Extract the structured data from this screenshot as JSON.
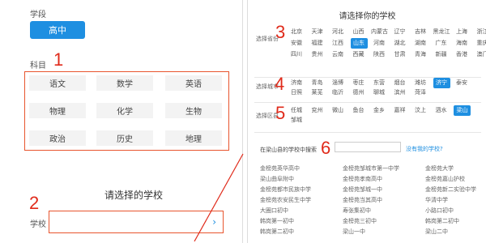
{
  "left": {
    "stage_label": "学段",
    "stage_value": "高中",
    "subject_label": "科目",
    "subjects": [
      "语文",
      "数学",
      "英语",
      "物理",
      "化学",
      "生物",
      "政治",
      "历史",
      "地理"
    ],
    "school_title": "请选择的学校",
    "school_label": "学校",
    "chevron": "›"
  },
  "right": {
    "title": "请选择你的学校",
    "province_label": "选择省份",
    "provinces": [
      "北京",
      "天津",
      "河北",
      "山西",
      "内蒙古",
      "辽宁",
      "吉林",
      "黑龙江",
      "上海",
      "浙江",
      "安徽",
      "福建",
      "江西",
      "山东",
      "河南",
      "湖北",
      "湖南",
      "广东",
      "海南",
      "重庆",
      "四川",
      "贵州",
      "云南",
      "西藏",
      "陕西",
      "甘肃",
      "青海",
      "新疆",
      "香港",
      "澳门"
    ],
    "selected_province": "山东",
    "city_label": "选择城市",
    "cities": [
      "济南",
      "青岛",
      "淄博",
      "枣庄",
      "东营",
      "烟台",
      "潍坊",
      "济宁",
      "泰安",
      "日照",
      "莱芜",
      "临沂",
      "德州",
      "聊城",
      "滨州",
      "菏泽"
    ],
    "selected_city": "济宁",
    "district_label": "选择区县",
    "districts": [
      "任城",
      "兖州",
      "微山",
      "鱼台",
      "金乡",
      "嘉祥",
      "汶上",
      "泗水",
      "梁山",
      "邹城"
    ],
    "selected_district": "梁山",
    "search_label": "在梁山县的学校中搜索",
    "no_school_link": "没有我的学校?",
    "schools": [
      [
        "金榜苑英华高中",
        "金榜苑邹城市第一中学",
        "金榜苑大学"
      ],
      [
        "梁山曲阜附中",
        "金榜苑孝南高中",
        "金榜苑嘉山护校"
      ],
      [
        "金榜苑都市民族中学",
        "金榜苑邹城一中",
        "金榜苑新二实验中学"
      ],
      [
        "金榜苑农安民生中学",
        "金榜苑当其高中",
        "华清中学"
      ],
      [
        "大圈口初中",
        "寿张集初中",
        "小路口初中"
      ],
      [
        "韩岗第一初中",
        "金榜苑三初中",
        "韩岗第二初中"
      ],
      [
        "韩岗第二初中",
        "梁山一中",
        "梁山二中"
      ]
    ]
  },
  "annotations": [
    "1",
    "2",
    "3",
    "4",
    "5",
    "6"
  ],
  "colors": {
    "accent": "#1e8fe1",
    "annotation": "#e02a1a",
    "highlight_border": "#e8552e"
  }
}
